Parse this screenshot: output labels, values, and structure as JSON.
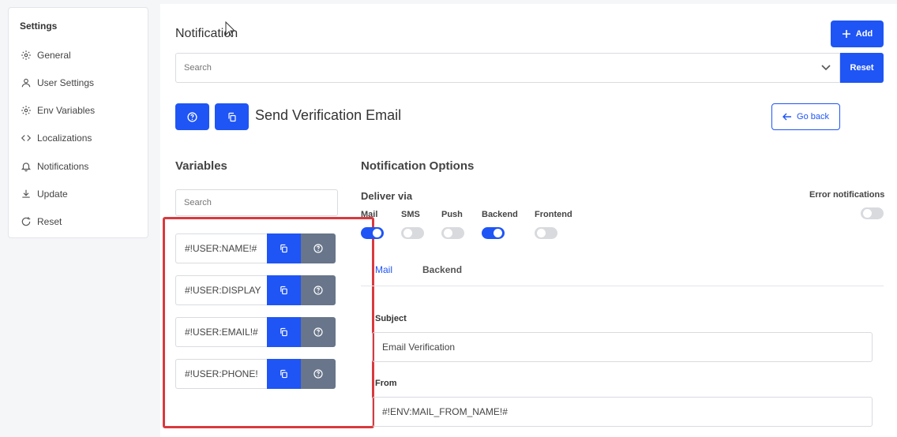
{
  "sidebar": {
    "title": "Settings",
    "items": [
      {
        "label": "General",
        "icon": "gear-icon"
      },
      {
        "label": "User Settings",
        "icon": "user-icon"
      },
      {
        "label": "Env Variables",
        "icon": "gear-icon"
      },
      {
        "label": "Localizations",
        "icon": "code-icon"
      },
      {
        "label": "Notifications",
        "icon": "bell-icon"
      },
      {
        "label": "Update",
        "icon": "download-icon"
      },
      {
        "label": "Reset",
        "icon": "refresh-icon"
      }
    ]
  },
  "header": {
    "title": "Notification",
    "add_label": "Add",
    "search_placeholder": "Search",
    "reset_label": "Reset"
  },
  "detail": {
    "title": "Send Verification Email",
    "back_label": "Go back"
  },
  "variables": {
    "heading": "Variables",
    "search_placeholder": "Search",
    "items": [
      "#!USER:NAME!#",
      "#!USER:DISPLAY",
      "#!USER:EMAIL!#",
      "#!USER:PHONE!"
    ]
  },
  "options": {
    "heading": "Notification Options",
    "deliver_label": "Deliver via",
    "error_label": "Error notifications",
    "channels": [
      {
        "label": "Mail",
        "on": true
      },
      {
        "label": "SMS",
        "on": false
      },
      {
        "label": "Push",
        "on": false
      },
      {
        "label": "Backend",
        "on": true
      },
      {
        "label": "Frontend",
        "on": false
      }
    ],
    "error_on": false,
    "tabs": [
      {
        "label": "Mail",
        "active": true
      },
      {
        "label": "Backend",
        "active": false
      }
    ],
    "subject_label": "Subject",
    "subject_value": "Email Verification",
    "from_label": "From",
    "from_value": "#!ENV:MAIL_FROM_NAME!#"
  },
  "colors": {
    "accent": "#1f55f5",
    "secondary": "#68758a",
    "highlight": "#d9393e"
  }
}
